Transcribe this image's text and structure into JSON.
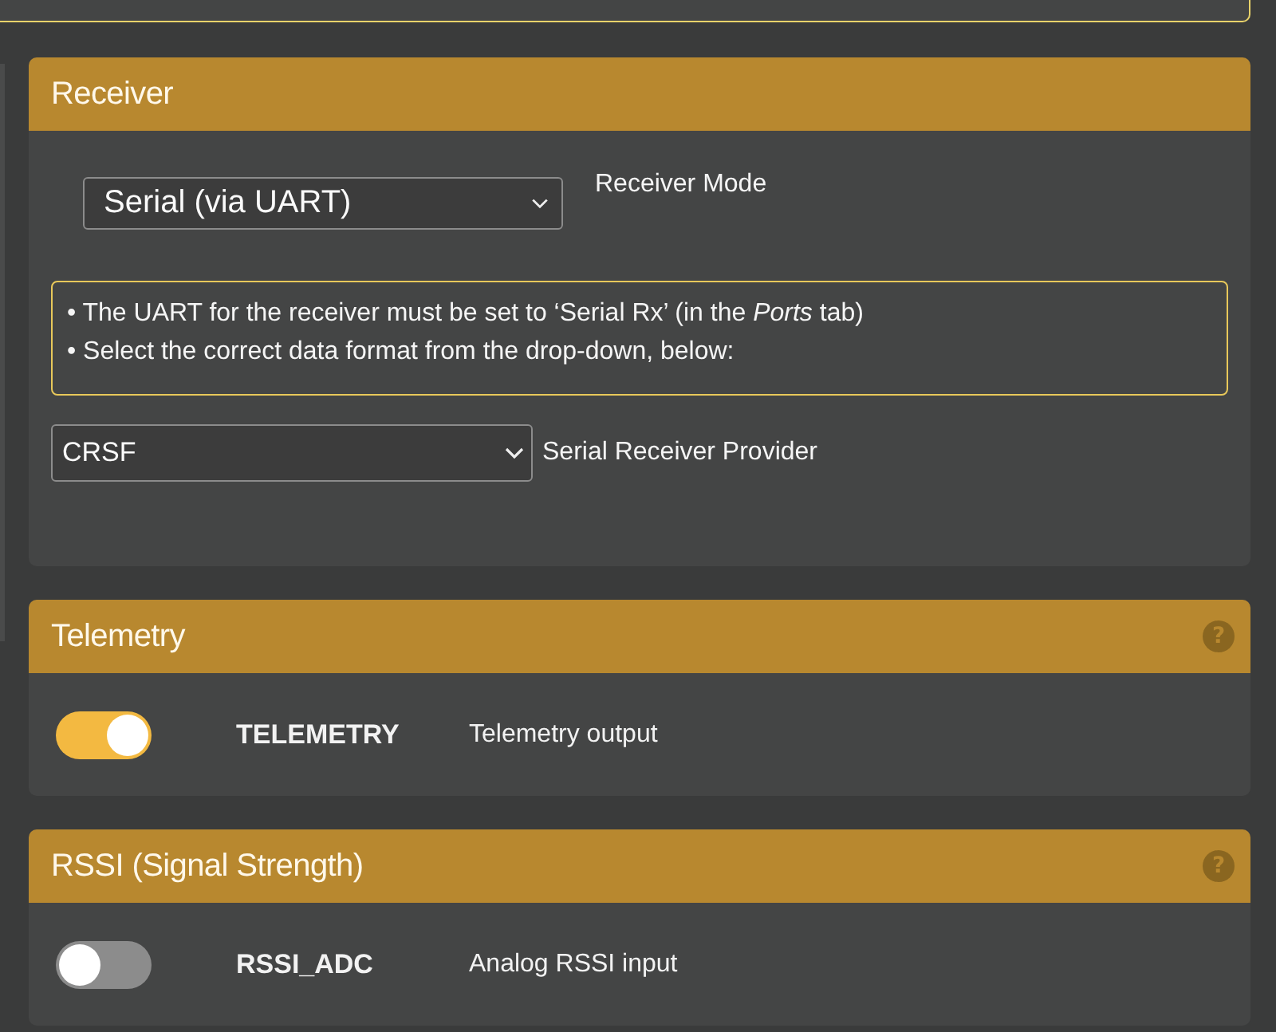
{
  "receiver": {
    "title": "Receiver",
    "mode": {
      "value": "Serial (via UART)",
      "label": "Receiver Mode"
    },
    "notes": [
      "• The UART for the receiver must be set to ‘Serial Rx’ (in the *Ports* tab)",
      "• Select the correct data format from the drop-down, below:"
    ],
    "provider": {
      "value": "CRSF",
      "label": "Serial Receiver Provider"
    }
  },
  "sections": [
    {
      "title": "Telemetry",
      "help": "?",
      "features": [
        {
          "name": "TELEMETRY",
          "description": "Telemetry output",
          "on": true
        }
      ]
    },
    {
      "title": "RSSI (Signal Strength)",
      "help": "?",
      "features": [
        {
          "name": "RSSI_ADC",
          "description": "Analog RSSI input",
          "on": false
        }
      ]
    }
  ]
}
